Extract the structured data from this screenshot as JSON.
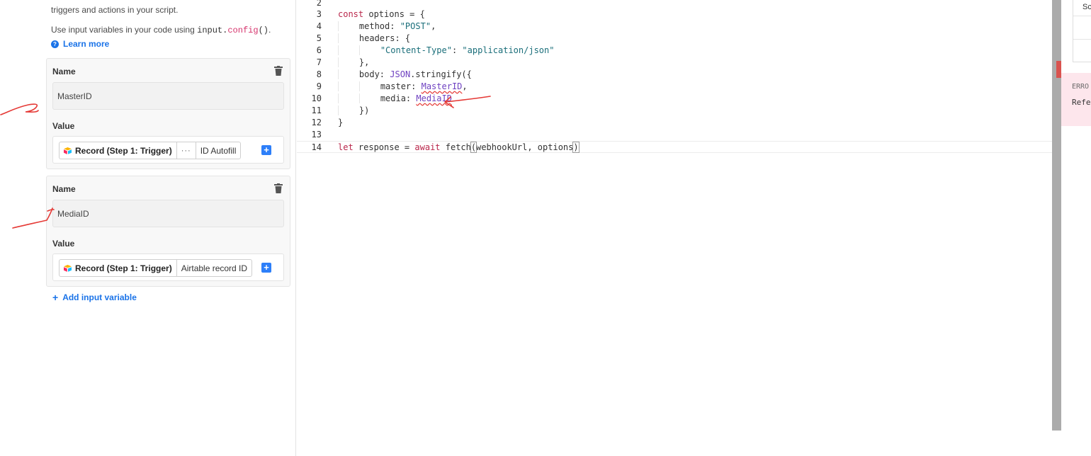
{
  "left_panel": {
    "intro_line": "triggers and actions in your script.",
    "usage_prefix": "Use input variables in your code using ",
    "usage_code_obj": "input",
    "usage_code_dot": ".",
    "usage_code_fn": "config",
    "usage_code_paren": "()",
    "usage_suffix": ".",
    "learn_more": "Learn more",
    "variables": [
      {
        "name_label": "Name",
        "name_value": "MasterID",
        "value_label": "Value",
        "token_record": "Record (Step 1: Trigger)",
        "token_more": "···",
        "token_field": "ID Autofill"
      },
      {
        "name_label": "Name",
        "name_value": "MediaID",
        "value_label": "Value",
        "token_record": "Record (Step 1: Trigger)",
        "token_field": "Airtable record ID"
      }
    ],
    "add_variable": "Add input variable"
  },
  "editor": {
    "line_numbers": [
      "2",
      "3",
      "4",
      "5",
      "6",
      "7",
      "8",
      "9",
      "10",
      "11",
      "12",
      "13",
      "14"
    ],
    "code": {
      "l3_kw": "const",
      "l3_rest": " options = {",
      "l4_key": "method: ",
      "l4_val": "\"POST\"",
      "l4_end": ",",
      "l5": "headers: {",
      "l6_key": "\"Content-Type\"",
      "l6_colon": ": ",
      "l6_val": "\"application/json\"",
      "l7": "},",
      "l8_key": "body: ",
      "l8_obj": "JSON",
      "l8_rest": ".stringify({",
      "l9_key": "master: ",
      "l9_var": "MasterID",
      "l9_end": ",",
      "l10_key": "media: ",
      "l10_var": "MediaID",
      "l11": "})",
      "l12": "}",
      "l14_kw1": "let",
      "l14_mid": " response = ",
      "l14_kw2": "await",
      "l14_fn": " fetch",
      "l14_open": "(",
      "l14_args": "webhookUrl, options",
      "l14_close": ")"
    }
  },
  "right_panel": {
    "cut_text": "Sc",
    "error_title": "ERRO",
    "error_msg": "Refe"
  },
  "colors": {
    "accent": "#2d7ff9",
    "link": "#1a73e8",
    "keyword": "#b9274b",
    "string": "#1a6e7a",
    "global": "#6f42c1",
    "error_bg": "#fde6ec",
    "annotation": "#e53935"
  }
}
